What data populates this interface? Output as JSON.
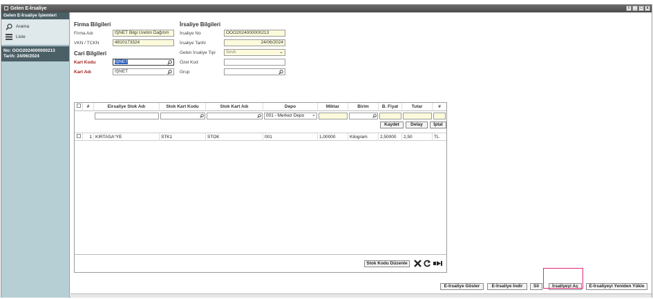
{
  "window": {
    "title": "Gelen E-İrsaliye",
    "controls": [
      "icon",
      "_",
      "□",
      "x"
    ]
  },
  "sidebar": {
    "header": "Gelen E-İrsaliye İşlemleri",
    "items": [
      {
        "label": "Arama",
        "icon": "search-icon"
      },
      {
        "label": "Liste",
        "icon": "list-icon"
      }
    ],
    "info_no": "No: OOO2024000000213",
    "info_date": "Tarih: 24/06/2024"
  },
  "firma": {
    "title": "Firma Bilgileri",
    "firma_adi_label": "Firma Adı",
    "firma_adi_value": "İŞNET Bilgi Üretim Dağıtım",
    "vkn_label": "VKN / TCKN",
    "vkn_value": "4810173324"
  },
  "irsaliye": {
    "title": "İrsaliye Bilgileri",
    "no_label": "İrsaliye No",
    "no_value": "OOO2024000000213",
    "tarih_label": "İrsaliye Tarihi",
    "tarih_value": "24/06/2024",
    "tip_label": "Gelen İrsaliye Tipi",
    "tip_value": "Sevk",
    "ozel_kod_label": "Özel Kod",
    "ozel_kod_value": "",
    "grup_label": "Grup",
    "grup_value": ""
  },
  "cari": {
    "title": "Cari Bilgileri",
    "kart_kodu_label": "Kart Kodu",
    "kart_kodu_value": "İŞNET",
    "kart_adi_label": "Kart Adı",
    "kart_adi_value": "İŞNET"
  },
  "grid": {
    "headers": [
      "#",
      "Eirsaliye Stok Adı",
      "Stok Kart Kodu",
      "Stok Kart Adı",
      "Depo",
      "Miktar",
      "Birim",
      "B. Fiyat",
      "Tutar",
      "#"
    ],
    "filter_depo": "001 - Merkez Depo",
    "actions": [
      "Kaydet",
      "Detay",
      "İptal"
    ],
    "rows": [
      {
        "no": "1",
        "eirsaliye_stok_adi": "KIRTASA°YE",
        "stok_kart_kodu": "STK1",
        "stok_kart_adi": "STOK",
        "depo": "001",
        "miktar": "1,00000",
        "birim": "Kilogram",
        "b_fiyat": "2,50000",
        "tutar": "2,50",
        "doviz": "TL"
      }
    ],
    "footer_button": "Stok Kodu Düzenle"
  },
  "buttons": {
    "goster": "E-İrsaliye Göster",
    "indir": "E-İrsaliye İndir",
    "sil": "Sil",
    "ac": "İrsaliyeyi Aç",
    "yeniden": "E-İrsaliyeyi Yeniden Yükle"
  },
  "colors": {
    "highlight": "#e0257a",
    "sidebar": "#b6cfd4",
    "readonly": "#fbfbdc",
    "required_label": "#a2231d"
  }
}
